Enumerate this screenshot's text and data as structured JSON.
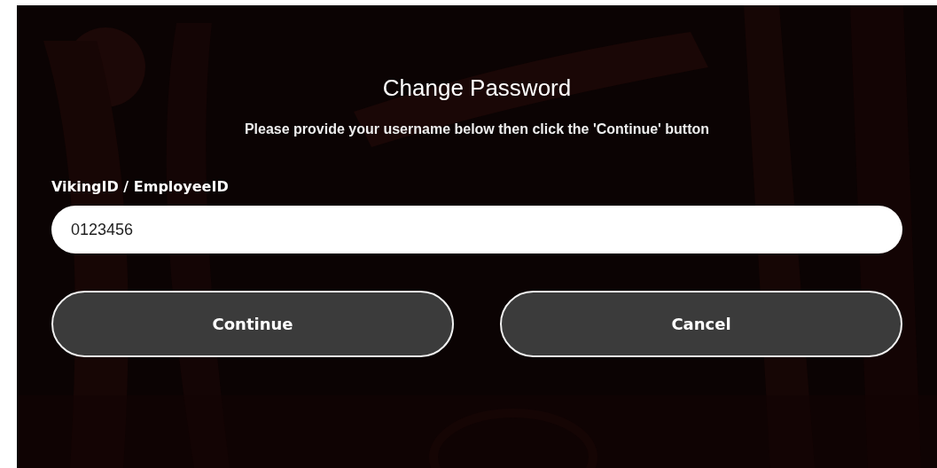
{
  "dialog": {
    "title": "Change Password",
    "instructions": "Please provide your username below then click the 'Continue' button"
  },
  "field": {
    "label": "VikingID / EmployeeID",
    "value": "0123456"
  },
  "buttons": [
    {
      "label": "Continue"
    },
    {
      "label": "Cancel"
    }
  ]
}
